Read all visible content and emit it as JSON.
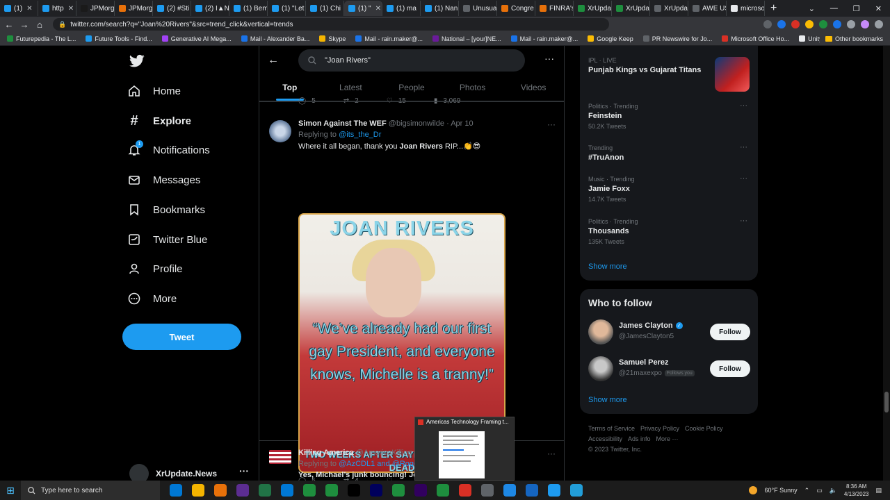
{
  "browser": {
    "tabs": [
      {
        "label": "(1)",
        "fav": "#1d9bf0"
      },
      {
        "label": "http",
        "fav": "#1d9bf0"
      },
      {
        "label": "JPMorg",
        "fav": "#1a1a1a"
      },
      {
        "label": "JPMorg",
        "fav": "#e8710a"
      },
      {
        "label": "(2) #Sti",
        "fav": "#1d9bf0"
      },
      {
        "label": "(2) I▲N",
        "fav": "#1d9bf0"
      },
      {
        "label": "(1) Bem",
        "fav": "#1d9bf0"
      },
      {
        "label": "(1) \"Let",
        "fav": "#1d9bf0"
      },
      {
        "label": "(1) Chi",
        "fav": "#1d9bf0"
      },
      {
        "label": "(1) \"",
        "fav": "#1d9bf0"
      },
      {
        "label": "(1) ma",
        "fav": "#1d9bf0"
      },
      {
        "label": "(1) Nan",
        "fav": "#1d9bf0"
      },
      {
        "label": "Unusua",
        "fav": "#5f6368"
      },
      {
        "label": "Congre",
        "fav": "#e8710a"
      },
      {
        "label": "FINRA's",
        "fav": "#e8710a"
      },
      {
        "label": "XrUpda",
        "fav": "#1e8e3e"
      },
      {
        "label": "XrUpda",
        "fav": "#1e8e3e"
      },
      {
        "label": "XrUpda",
        "fav": "#5f6368"
      },
      {
        "label": "AWE US",
        "fav": "#5f6368"
      },
      {
        "label": "microso",
        "fav": "#e8eaed"
      }
    ],
    "active_tab_index": 9,
    "new_tab_symbol": "+",
    "window_controls": [
      "⌄",
      "—",
      "❐",
      "✕"
    ],
    "url": "twitter.com/search?q=\"Joan%20Rivers\"&src=trend_click&vertical=trends",
    "bookmarks": [
      {
        "label": "Futurepedia - The L...",
        "color": "#1e8e3e"
      },
      {
        "label": "Future Tools - Find...",
        "color": "#1d9bf0"
      },
      {
        "label": "Generative AI Mega...",
        "color": "#a142f4"
      },
      {
        "label": "Mail - Alexander Ba...",
        "color": "#1a73e8"
      },
      {
        "label": "Skype",
        "color": "#f4b400"
      },
      {
        "label": "Mail - rain.maker@...",
        "color": "#1a73e8"
      },
      {
        "label": "National – [your]NE...",
        "color": "#6a1b9a"
      },
      {
        "label": "Mail - rain.maker@...",
        "color": "#1a73e8"
      },
      {
        "label": "Google Keep",
        "color": "#fbbc04"
      },
      {
        "label": "PR Newswire for Jo...",
        "color": "#5f6368"
      },
      {
        "label": "Microsoft Office Ho...",
        "color": "#d93025"
      },
      {
        "label": "Unity - Manual: Uni...",
        "color": "#e8eaed"
      }
    ],
    "other_bookmarks": "Other bookmarks"
  },
  "nav": {
    "items": [
      {
        "label": "Home",
        "icon": "home-icon"
      },
      {
        "label": "Explore",
        "icon": "hashtag-icon"
      },
      {
        "label": "Notifications",
        "icon": "bell-icon"
      },
      {
        "label": "Messages",
        "icon": "envelope-icon"
      },
      {
        "label": "Bookmarks",
        "icon": "bookmark-icon"
      },
      {
        "label": "Twitter Blue",
        "icon": "twitter-blue-icon"
      },
      {
        "label": "Profile",
        "icon": "person-icon"
      },
      {
        "label": "More",
        "icon": "more-circle-icon"
      }
    ],
    "notifications_badge": "1",
    "tweet_label": "Tweet",
    "account_name": "XrUpdate.News"
  },
  "search": {
    "query": "\"Joan Rivers\"",
    "tabs": [
      "Top",
      "Latest",
      "People",
      "Photos",
      "Videos"
    ],
    "active_tab": "Top"
  },
  "prev_tweet_actions": {
    "replies": "5",
    "retweets": "2",
    "likes": "15",
    "views": "3,069"
  },
  "tweet1": {
    "name": "Simon Against The WEF",
    "handle": "@bigsimonwilde",
    "date": "· Apr 10",
    "replying_prefix": "Replying to",
    "replying_to": "@its_the_Dr",
    "text_before": "Where it all began, thank you ",
    "text_bold": "Joan Rivers",
    "text_after": " RIP...👏😎",
    "image_title": "JOAN RIVERS",
    "image_quote": "“We’ve already had our first gay President, and everyone knows, Michelle is a tranny!”",
    "image_caption": "TWO WEEKS AFTER SAYING THIS, SHE WAS DEAD",
    "replies": "5",
    "retweets": "4"
  },
  "tweet2": {
    "name": "Killing America",
    "handle": "@AmericaKilling",
    "replying_prefix": "Replying to",
    "replying_to": "@AzCDL1 and @Roge",
    "text": "Yes, Michael’s junk bouncing! Joa"
  },
  "trends": [
    {
      "category": "IPL · LIVE",
      "title": "Punjab Kings vs Gujarat Titans",
      "count": ""
    },
    {
      "category": "Politics · Trending",
      "title": "Feinstein",
      "count": "50.2K Tweets"
    },
    {
      "category": "Trending",
      "title": "#TruAnon",
      "count": ""
    },
    {
      "category": "Music · Trending",
      "title": "Jamie Foxx",
      "count": "14.7K Tweets"
    },
    {
      "category": "Politics · Trending",
      "title": "Thousands",
      "count": "135K Tweets"
    }
  ],
  "trends_show_more": "Show more",
  "who_to_follow": {
    "title": "Who to follow",
    "people": [
      {
        "name": "James Clayton",
        "handle": "@JamesClayton5",
        "verified": true,
        "follows_you": ""
      },
      {
        "name": "Samuel Perez",
        "handle": "@21maxexpo",
        "verified": false,
        "follows_you": "Follows you"
      }
    ],
    "follow_label": "Follow",
    "show_more": "Show more"
  },
  "footer": {
    "links": [
      "Terms of Service",
      "Privacy Policy",
      "Cookie Policy",
      "Accessibility",
      "Ads info",
      "More ···"
    ],
    "copyright": "© 2023 Twitter, Inc."
  },
  "popup": {
    "title": "Americas Technology Framing t..."
  },
  "taskbar": {
    "search_placeholder": "Type here to search",
    "apps": [
      "#0078d4",
      "#f4b400",
      "#e8710a",
      "#5c2d91",
      "#217346",
      "#0078d4",
      "#1e8e3e",
      "#1e8e3e",
      "#000000",
      "#00005b",
      "#1e8e3e",
      "#31005e",
      "#1e8e3e",
      "#d93025",
      "#5f6368",
      "#1e88e5",
      "#1565c0",
      "#1d9bf0",
      "#229ed9"
    ],
    "weather": "60°F  Sunny",
    "time": "8:36 AM",
    "date": "4/13/2023"
  }
}
